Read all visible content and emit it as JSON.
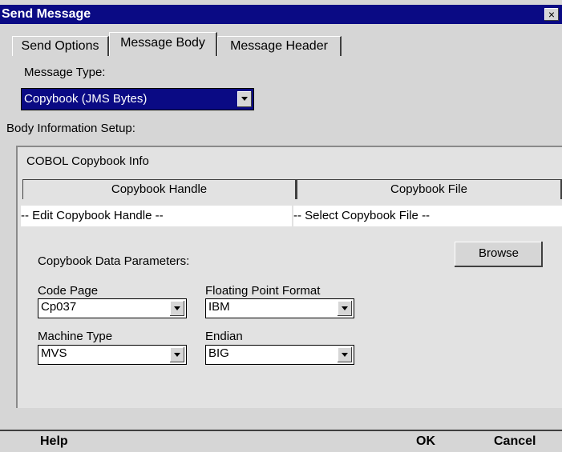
{
  "window": {
    "title": "Send Message",
    "close_symbol": "×"
  },
  "tabs": [
    {
      "label": "Send Options",
      "active": false
    },
    {
      "label": "Message Body",
      "active": true
    },
    {
      "label": "Message Header",
      "active": false
    }
  ],
  "message_type": {
    "label": "Message Type:",
    "value": "Copybook (JMS Bytes)"
  },
  "body_info": {
    "label": "Body Information Setup:",
    "panel_title": "COBOL Copybook Info",
    "columns": [
      "Copybook Handle",
      "Copybook File"
    ],
    "row": [
      "-- Edit Copybook Handle --",
      "-- Select Copybook File --"
    ],
    "params_label": "Copybook Data Parameters:",
    "browse_label": "Browse"
  },
  "fields": {
    "code_page": {
      "label": "Code Page",
      "value": "Cp037"
    },
    "floating_point": {
      "label": "Floating Point Format",
      "value": "IBM"
    },
    "machine_type": {
      "label": "Machine Type",
      "value": "MVS"
    },
    "endian": {
      "label": "Endian",
      "value": "BIG"
    }
  },
  "footer": {
    "help": "Help",
    "ok": "OK",
    "cancel": "Cancel"
  },
  "colors": {
    "title_bg": "#0a0a84",
    "selected_bg": "#0a0a84",
    "window_bg": "#d6d6d6"
  }
}
